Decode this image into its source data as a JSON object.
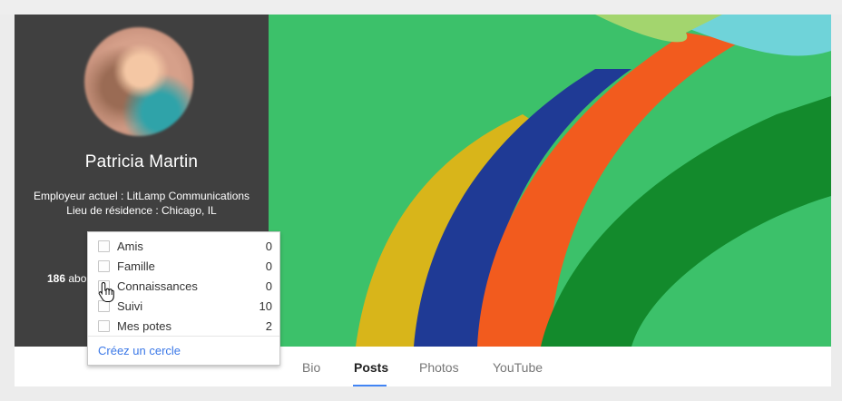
{
  "profile": {
    "name": "Patricia Martin",
    "employer_line": "Employeur actuel : LitLamp Communications",
    "residence_line": "Lieu de résidence : Chicago, IL",
    "followers_count": "186",
    "followers_label": " abo"
  },
  "tabs": [
    {
      "label": "Bio"
    },
    {
      "label": "Posts",
      "active": true
    },
    {
      "label": "Photos"
    },
    {
      "label": "YouTube"
    }
  ],
  "circles_menu": {
    "items": [
      {
        "label": "Amis",
        "count": "0"
      },
      {
        "label": "Famille",
        "count": "0"
      },
      {
        "label": "Connaissances",
        "count": "0"
      },
      {
        "label": "Suivi",
        "count": "10"
      },
      {
        "label": "Mes potes",
        "count": "2"
      }
    ],
    "create_label": "Créez un cercle"
  },
  "colors": {
    "panel_bg": "#404040",
    "accent": "#4285f4",
    "link": "#3b78e7",
    "cover_green": "#3cc16a"
  }
}
